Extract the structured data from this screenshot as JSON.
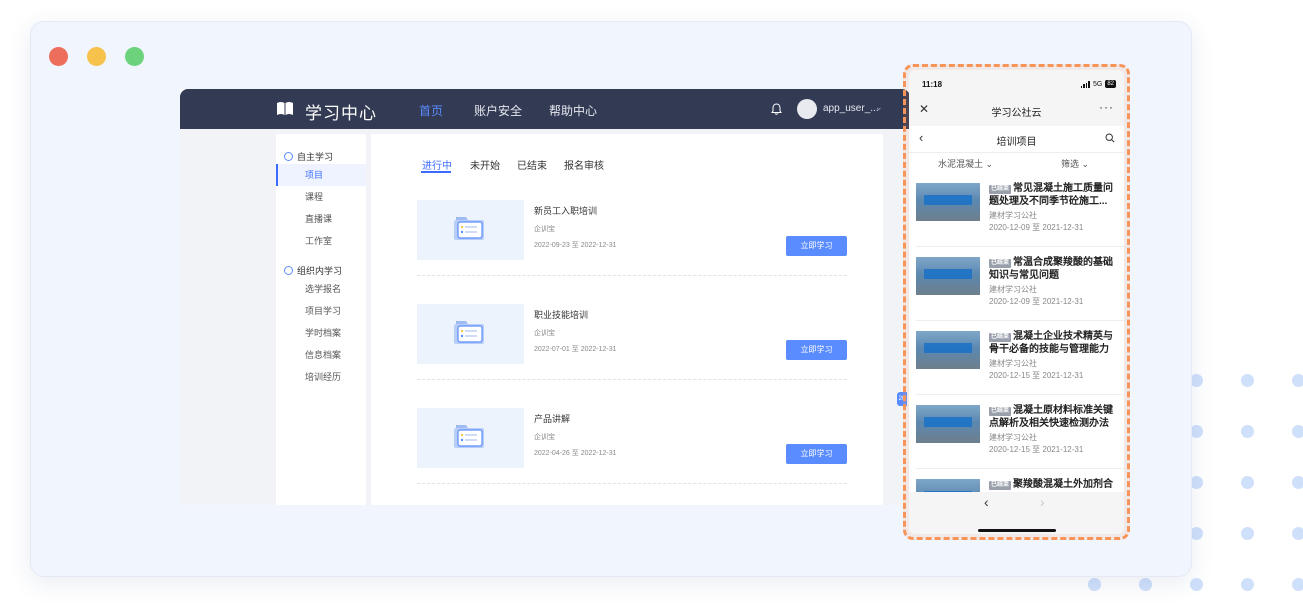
{
  "app": {
    "logo_text": "学习中心",
    "nav": [
      "首页",
      "账户安全",
      "帮助中心"
    ],
    "username": "app_user_...",
    "caret": "⌄"
  },
  "sidebar": {
    "groups": [
      {
        "title": "自主学习",
        "items": [
          "项目",
          "课程",
          "直播课",
          "工作室"
        ]
      },
      {
        "title": "组织内学习",
        "items": [
          "选学报名",
          "项目学习",
          "学时档案",
          "信息档案",
          "培训经历"
        ]
      }
    ]
  },
  "tabs": [
    "进行中",
    "未开始",
    "已结束",
    "报名审核"
  ],
  "courses": [
    {
      "title": "新员工入职培训",
      "org": "企训宝",
      "date": "2022-09-23 至 2022-12-31",
      "button": "立即学习"
    },
    {
      "title": "职业技能培训",
      "org": "企训宝",
      "date": "2022-07-01 至 2022-12-31",
      "button": "立即学习"
    },
    {
      "title": "产品讲解",
      "org": "企训宝",
      "date": "2022-04-26 至 2022-12-31",
      "button": "立即学习"
    }
  ],
  "side_badge": "20",
  "phone": {
    "time": "11:18",
    "network": "5G",
    "battery": "82",
    "mp_title": "学习公社云",
    "more": "···",
    "close": "✕",
    "page_title": "培训项目",
    "filter_left": "水泥混凝土 ⌄",
    "filter_right": "筛选 ⌄",
    "items": [
      {
        "tag": "已结束",
        "title": "常见混凝土施工质量问题处理及不同季节砼施工...",
        "org": "建材学习公社",
        "date": "2020-12-09 至 2021-12-31"
      },
      {
        "tag": "已结束",
        "title": "常温合成聚羧酸的基础知识与常见问题",
        "org": "建材学习公社",
        "date": "2020-12-09 至 2021-12-31"
      },
      {
        "tag": "已结束",
        "title": "混凝土企业技术精英与骨干必备的技能与管理能力",
        "org": "建材学习公社",
        "date": "2020-12-15 至 2021-12-31"
      },
      {
        "tag": "已结束",
        "title": "混凝土原材料标准关键点解析及相关快速检测办法",
        "org": "建材学习公社",
        "date": "2020-12-15 至 2021-12-31"
      },
      {
        "tag": "已结束",
        "title": "聚羧酸混凝土外加剂合",
        "org": "",
        "date": ""
      }
    ],
    "nav_back": "‹",
    "nav_forward": "›"
  },
  "colors": {
    "navbar": "#333a53",
    "accent": "#5b8cff",
    "phone_border": "#f7945a"
  }
}
